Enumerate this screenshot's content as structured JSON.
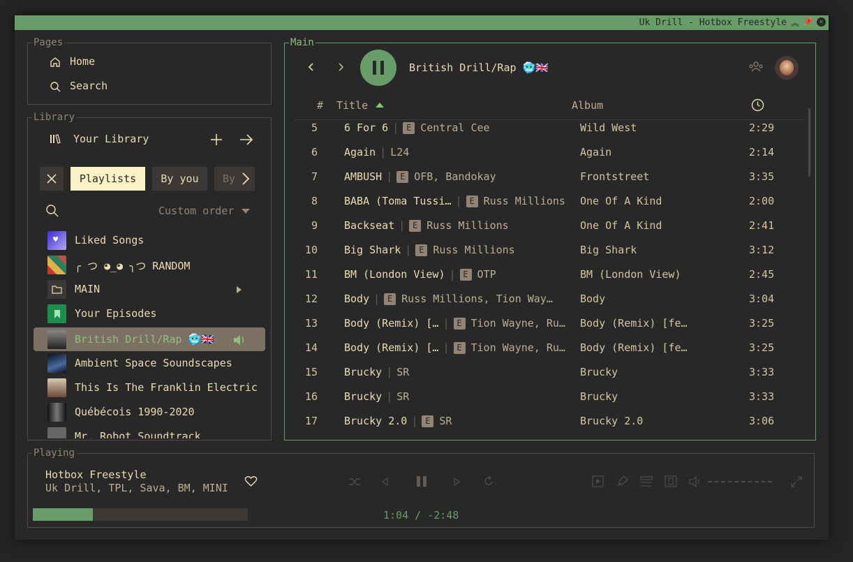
{
  "window": {
    "title": "Uk Drill - Hotbox Freestyle"
  },
  "pages": {
    "legend": "Pages",
    "items": [
      {
        "label": "Home",
        "icon": "home-icon"
      },
      {
        "label": "Search",
        "icon": "search-icon"
      }
    ]
  },
  "library": {
    "legend": "Library",
    "header": "Your Library",
    "chips": [
      "Playlists",
      "By you",
      "By"
    ],
    "sort_label": "Custom order",
    "items": [
      {
        "name": "Liked Songs",
        "thumb": "#7b6df0"
      },
      {
        "name": "╭ つ ◕_◕ ╮つ RANDOM",
        "thumb": "#b4544b"
      },
      {
        "name": "MAIN",
        "thumb": "#3c3836"
      },
      {
        "name": "Your Episodes",
        "thumb": "#1e8c4a"
      },
      {
        "name": "British Drill/Rap 🥶🇬🇧",
        "thumb": "#444"
      },
      {
        "name": "Ambient Space Soundscapes",
        "thumb": "#1a2438"
      },
      {
        "name": "This Is The Franklin Electric",
        "thumb": "#6b4a3c"
      },
      {
        "name": "Québécois 1990-2020",
        "thumb": "#222"
      },
      {
        "name": "Mr. Robot Soundtrack",
        "thumb": "#555"
      }
    ]
  },
  "main": {
    "legend": "Main",
    "playlist_title": "British Drill/Rap 🥶🇬🇧",
    "columns": {
      "num": "#",
      "title": "Title",
      "album": "Album"
    },
    "tracks": [
      {
        "n": "5",
        "title": "6 For 6",
        "explicit": true,
        "artist": "Central Cee",
        "album": "Wild West",
        "dur": "2:29"
      },
      {
        "n": "6",
        "title": "Again",
        "explicit": false,
        "artist": "L24",
        "album": "Again",
        "dur": "2:14"
      },
      {
        "n": "7",
        "title": "AMBUSH",
        "explicit": true,
        "artist": "OFB, Bandokay",
        "album": "Frontstreet",
        "dur": "3:35"
      },
      {
        "n": "8",
        "title": "BABA (Toma Tussi…",
        "explicit": true,
        "artist": "Russ Millions",
        "album": "One Of A Kind",
        "dur": "2:00"
      },
      {
        "n": "9",
        "title": "Backseat",
        "explicit": true,
        "artist": "Russ Millions",
        "album": "One Of A Kind",
        "dur": "2:41"
      },
      {
        "n": "10",
        "title": "Big Shark",
        "explicit": true,
        "artist": "Russ Millions",
        "album": "Big Shark",
        "dur": "3:12"
      },
      {
        "n": "11",
        "title": "BM (London View)",
        "explicit": true,
        "artist": "OTP",
        "album": "BM (London View)",
        "dur": "2:45"
      },
      {
        "n": "12",
        "title": "Body",
        "explicit": true,
        "artist": "Russ Millions, Tion Way…",
        "album": "Body",
        "dur": "3:04"
      },
      {
        "n": "13",
        "title": "Body (Remix) […",
        "explicit": true,
        "artist": "Tion Wayne, Ru…",
        "album": "Body (Remix) [fe…",
        "dur": "3:25"
      },
      {
        "n": "14",
        "title": "Body (Remix) […",
        "explicit": true,
        "artist": "Tion Wayne, Ru…",
        "album": "Body (Remix) [fe…",
        "dur": "3:25"
      },
      {
        "n": "15",
        "title": "Brucky",
        "explicit": false,
        "artist": "SR",
        "album": "Brucky",
        "dur": "3:33"
      },
      {
        "n": "16",
        "title": "Brucky",
        "explicit": false,
        "artist": "SR",
        "album": "Brucky",
        "dur": "3:33"
      },
      {
        "n": "17",
        "title": "Brucky 2.0",
        "explicit": true,
        "artist": "SR",
        "album": "Brucky 2.0",
        "dur": "3:06"
      }
    ]
  },
  "playing": {
    "legend": "Playing",
    "track": "Hotbox Freestyle",
    "artists": "Uk Drill, TPL, Sava, BM, MINI",
    "time": "1:04 / -2:48",
    "progress": 0.28
  },
  "colors": {
    "accent": "#689d6a",
    "accent_light": "#8ec07c",
    "bg": "#282828",
    "fg": "#ebdbb2"
  }
}
